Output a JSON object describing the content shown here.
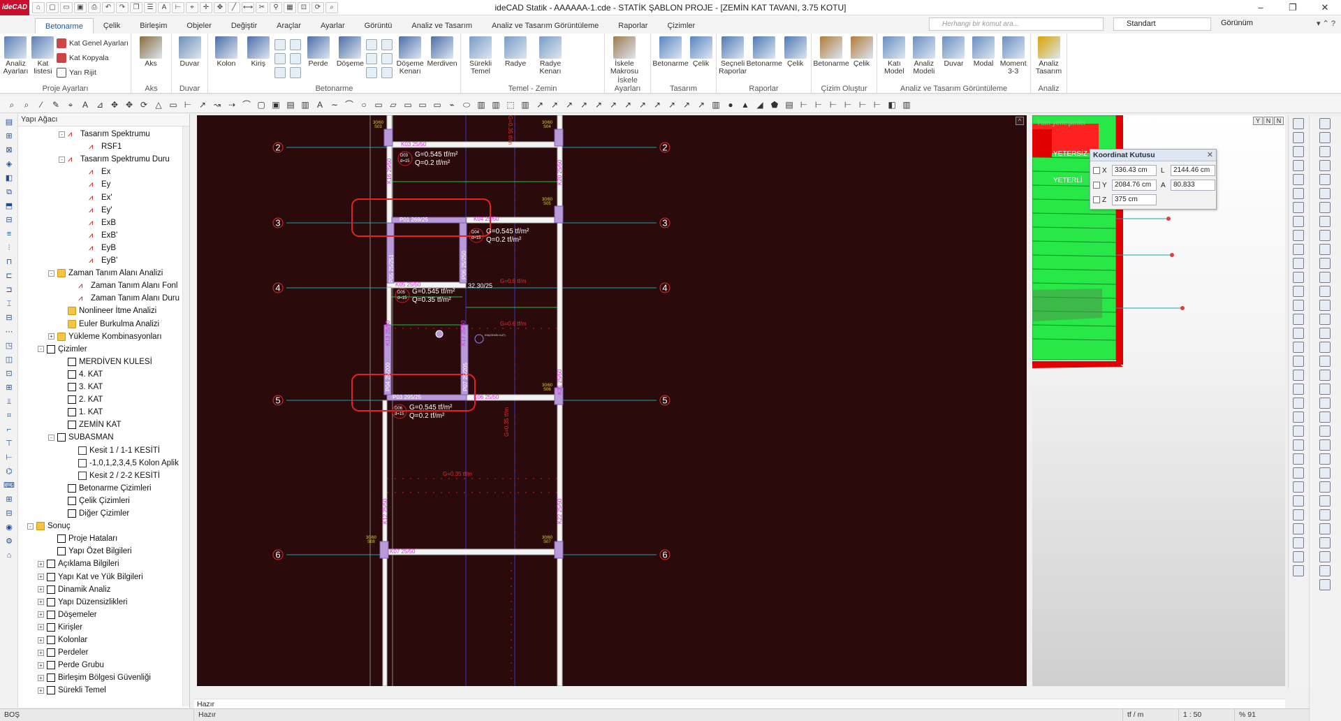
{
  "app": {
    "logo": "ideCAD",
    "title": "ideCAD Statik - AAAAAA-1.cde - STATİK ŞABLON PROJE - [ZEMİN KAT TAVANI,  3.75 KOTU]",
    "window_controls": [
      "–",
      "❐",
      "✕"
    ]
  },
  "ribbon_tabs": [
    "Betonarme",
    "Çelik",
    "Birleşim",
    "Objeler",
    "Değiştir",
    "Araçlar",
    "Ayarlar",
    "Görüntü",
    "Analiz ve Tasarım",
    "Analiz ve Tasarım Görüntüleme",
    "Raporlar",
    "Çizimler"
  ],
  "active_tab": "Betonarme",
  "search_placeholder": "Herhangi bir komut ara...",
  "style_select": "Standart",
  "view_label": "Görünüm",
  "ribbon_groups": [
    {
      "label": "Proje Ayarları",
      "big": [
        "Analiz\nAyarları",
        "Kat\nlistesi"
      ],
      "small": [
        "Kat Genel Ayarları",
        "Kat Kopyala",
        "Yarı Rijit"
      ]
    },
    {
      "label": "Aks",
      "big": [
        "Aks"
      ]
    },
    {
      "label": "Duvar",
      "big": [
        "Duvar"
      ]
    },
    {
      "label": "Betonarme",
      "big": [
        "Kolon",
        "Kiriş",
        "Perde",
        "Döşeme",
        "Döşeme\nKenarı",
        "Merdiven"
      ]
    },
    {
      "label": "Temel - Zemin",
      "big": [
        "Sürekli\nTemel",
        "Radye",
        "Radye\nKenarı"
      ]
    },
    {
      "label": "İskele Ayarları",
      "big": [
        "İskele\nMakrosu"
      ]
    },
    {
      "label": "Tasarım",
      "big": [
        "Betonarme",
        "Çelik"
      ]
    },
    {
      "label": "Raporlar",
      "big": [
        "Seçneli\nRaporlar",
        "Betonarme",
        "Çelik"
      ]
    },
    {
      "label": "Çizim Oluştur",
      "big": [
        "Betonarme",
        "Çelik"
      ]
    },
    {
      "label": "Analiz ve Tasarım Görüntüleme",
      "big": [
        "Katı\nModel",
        "Analiz\nModeli",
        "Duvar",
        "Modal",
        "Moment\n3-3"
      ]
    },
    {
      "label": "Analiz",
      "big": [
        "Analiz\nTasarım"
      ]
    }
  ],
  "tree": {
    "title": "Yapı Ağacı",
    "items": [
      {
        "label": "Tasarım Spektrumu",
        "indent": 3,
        "icon": "red",
        "pm": "-"
      },
      {
        "label": "RSF1",
        "indent": 5,
        "icon": "red"
      },
      {
        "label": "Tasarım Spektrumu Duru",
        "indent": 3,
        "icon": "red",
        "pm": "-"
      },
      {
        "label": "Ex",
        "indent": 5,
        "icon": "red"
      },
      {
        "label": "Ey",
        "indent": 5,
        "icon": "red"
      },
      {
        "label": "Ex'",
        "indent": 5,
        "icon": "red"
      },
      {
        "label": "Ey'",
        "indent": 5,
        "icon": "red"
      },
      {
        "label": "ExB",
        "indent": 5,
        "icon": "red"
      },
      {
        "label": "ExB'",
        "indent": 5,
        "icon": "red"
      },
      {
        "label": "EyB",
        "indent": 5,
        "icon": "red"
      },
      {
        "label": "EyB'",
        "indent": 5,
        "icon": "red"
      },
      {
        "label": "Zaman Tanım Alanı Analizi",
        "indent": 2,
        "icon": "fold",
        "pm": "-"
      },
      {
        "label": "Zaman Tanım Alanı Fonl",
        "indent": 4,
        "icon": "red"
      },
      {
        "label": "Zaman Tanım Alanı Duru",
        "indent": 4,
        "icon": "red"
      },
      {
        "label": "Nonlineer İtme Analizi",
        "indent": 3,
        "icon": "fold"
      },
      {
        "label": "Euler Burkulma Analizi",
        "indent": 3,
        "icon": "fold"
      },
      {
        "label": "Yükleme Kombinasyonları",
        "indent": 2,
        "icon": "fold",
        "pm": "+"
      },
      {
        "label": "Çizimler",
        "indent": 1,
        "icon": "doc",
        "pm": "-"
      },
      {
        "label": "MERDİVEN KULESİ",
        "indent": 3,
        "icon": "doc"
      },
      {
        "label": "4. KAT",
        "indent": 3,
        "icon": "doc"
      },
      {
        "label": "3. KAT",
        "indent": 3,
        "icon": "doc"
      },
      {
        "label": "2. KAT",
        "indent": 3,
        "icon": "doc"
      },
      {
        "label": "1. KAT",
        "indent": 3,
        "icon": "doc"
      },
      {
        "label": "ZEMİN KAT",
        "indent": 3,
        "icon": "doc"
      },
      {
        "label": "SUBASMAN",
        "indent": 2,
        "icon": "doc",
        "pm": "-"
      },
      {
        "label": "Kesit 1 / 1-1 KESİTİ",
        "indent": 4,
        "icon": "grid"
      },
      {
        "label": "-1,0,1,2,3,4,5 Kolon Aplik",
        "indent": 4,
        "icon": "grid"
      },
      {
        "label": "Kesit 2 / 2-2 KESİTİ",
        "indent": 4,
        "icon": "grid"
      },
      {
        "label": "Betonarme Çizimleri",
        "indent": 3,
        "icon": "doc"
      },
      {
        "label": "Çelik Çizimleri",
        "indent": 3,
        "icon": "doc"
      },
      {
        "label": "Diğer Çizimler",
        "indent": 3,
        "icon": "doc"
      },
      {
        "label": "Sonuç",
        "indent": 0,
        "icon": "fold",
        "pm": "-"
      },
      {
        "label": "Proje Hataları",
        "indent": 2,
        "icon": "doc"
      },
      {
        "label": "Yapı Özet Bilgileri",
        "indent": 2,
        "icon": "doc"
      },
      {
        "label": "Açıklama Bilgileri",
        "indent": 1,
        "icon": "doc",
        "pm": "+"
      },
      {
        "label": "Yapı Kat ve Yük Bilgileri",
        "indent": 1,
        "icon": "doc",
        "pm": "+"
      },
      {
        "label": "Dinamik Analiz",
        "indent": 1,
        "icon": "doc",
        "pm": "+"
      },
      {
        "label": "Yapı Düzensizlikleri",
        "indent": 1,
        "icon": "doc",
        "pm": "+"
      },
      {
        "label": "Döşemeler",
        "indent": 1,
        "icon": "doc",
        "pm": "+"
      },
      {
        "label": "Kirişler",
        "indent": 1,
        "icon": "doc",
        "pm": "+"
      },
      {
        "label": "Kolonlar",
        "indent": 1,
        "icon": "doc",
        "pm": "+"
      },
      {
        "label": "Perdeler",
        "indent": 1,
        "icon": "doc",
        "pm": "+"
      },
      {
        "label": "Perde Grubu",
        "indent": 1,
        "icon": "doc",
        "pm": "+"
      },
      {
        "label": "Birleşim Bölgesi Güvenliği",
        "indent": 1,
        "icon": "doc",
        "pm": "+"
      },
      {
        "label": "Sürekli Temel",
        "indent": 1,
        "icon": "doc",
        "pm": "+"
      }
    ]
  },
  "drawing": {
    "axes": [
      "2",
      "3",
      "4",
      "5",
      "6"
    ],
    "beams": [
      "K03  25/50",
      "K04  25/50",
      "K05  25/50",
      "K06  25/50",
      "K07  25/50",
      "K16  25/50",
      "K20  25/50",
      "K13  25/50",
      "K17  25/50",
      "K21  25/50",
      "K12  25/50",
      "K22  25/50"
    ],
    "walls": [
      "P01  269/25",
      "P03  295/25",
      "P05  25/251",
      "P06  25/250",
      "P04  25/200",
      "P07  25/205"
    ],
    "columns": [
      "30/60\nS03",
      "30/60\nS04",
      "30/60\nS05",
      "30/60\nS06",
      "30/60\nS08",
      "30/60\nS07"
    ],
    "slabs": [
      {
        "id": "D03",
        "d": "d=15",
        "g": "G=0.545 tf/m²",
        "q": "Q=0.2 tf/m²"
      },
      {
        "id": "D04",
        "d": "d=15",
        "g": "G=0.545 tf/m²",
        "q": "Q=0.2 tf/m²"
      },
      {
        "id": "D05",
        "d": "d=15",
        "g": "G=0.545 tf/m²",
        "q": "Q=0.35 tf/m²"
      },
      {
        "id": "D06",
        "d": "d=15",
        "g": "G=0.545 tf/m²",
        "q": "Q=0.2 tf/m²"
      }
    ],
    "loads": [
      "G=0.35 tf/m",
      "G=0.6 tf/m",
      "G=0.6 tf/m",
      "G=0.35 tf/m",
      "32.30/25",
      "G=0.35 tf/m"
    ],
    "stair_label": "KM(ZEMİN KAT)"
  },
  "view3d": {
    "header": "Tüm yerleşimler",
    "labels": [
      "YETERSİZ",
      "YETERLİ"
    ],
    "nav": [
      "Y",
      "N",
      "N"
    ]
  },
  "coord_box": {
    "title": "Koordinat Kutusu",
    "x_label": "X",
    "x_value": "336.43 cm",
    "l_label": "L",
    "l_value": "2144.46 cm",
    "y_label": "Y",
    "y_value": "2084.76 cm",
    "a_label": "A",
    "a_value": "80.833",
    "z_label": "Z",
    "z_value": "375 cm"
  },
  "command_line": "Hazır",
  "status": {
    "left": "BOŞ",
    "middle": "Hazır",
    "unit": "tf / m",
    "scale": "1 : 50",
    "zoom": "% 91"
  }
}
